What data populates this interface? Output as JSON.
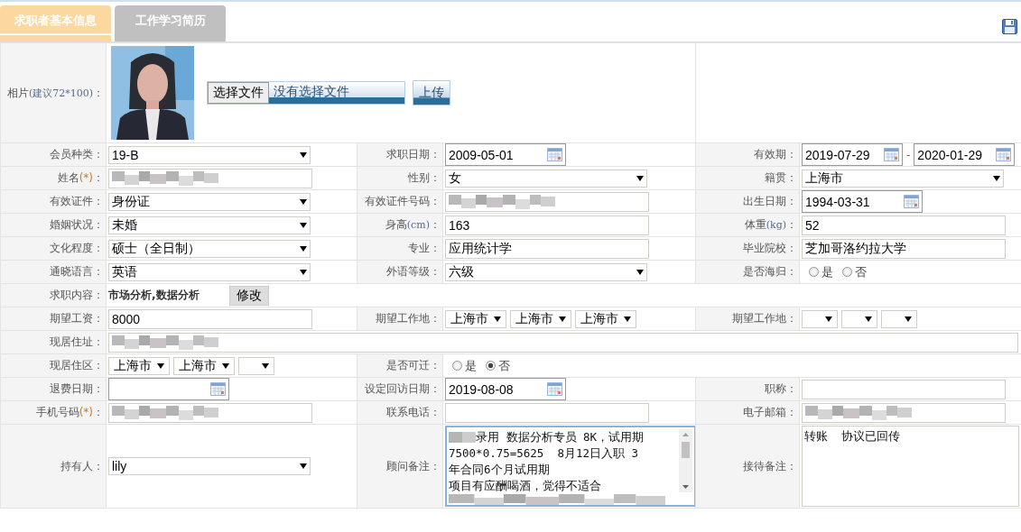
{
  "tabs": [
    {
      "label": "求职者基本信息",
      "selected": true
    },
    {
      "label": "工作学习简历",
      "selected": false
    }
  ],
  "rows": [
    {
      "label": [
        {
          "text": "相片"
        },
        {
          "text": "(建议72*100)",
          "kind": "hint"
        },
        {
          "text": "："
        }
      ],
      "upload": {
        "choose_button": "选择文件",
        "file_status": "没有选择文件",
        "upload_button": "上传"
      }
    },
    {
      "kind": "fields",
      "cells": [
        {
          "label": [
            {
              "text": "会员种类："
            }
          ],
          "field": {
            "kind": "select",
            "value": "19-B"
          }
        },
        {
          "label": [
            {
              "text": "求职日期："
            }
          ],
          "field": {
            "kind": "date",
            "value": "2009-05-01"
          }
        },
        {
          "label": [
            {
              "text": "有效期："
            }
          ],
          "field": {
            "kind": "daterange",
            "from": "2019-07-29",
            "separator": "-",
            "to": "2020-01-29"
          }
        }
      ]
    },
    {
      "kind": "fields",
      "cells": [
        {
          "label": [
            {
              "text": "姓名"
            },
            {
              "text": "(*)",
              "kind": "required"
            },
            {
              "text": "："
            }
          ],
          "field": {
            "kind": "text",
            "redacted": true
          }
        },
        {
          "label": [
            {
              "text": "性别："
            }
          ],
          "field": {
            "kind": "select",
            "value": "女"
          }
        },
        {
          "label": [
            {
              "text": "籍贯："
            }
          ],
          "field": {
            "kind": "select",
            "value": "上海市"
          }
        }
      ]
    },
    {
      "kind": "fields",
      "cells": [
        {
          "label": [
            {
              "text": "有效证件："
            }
          ],
          "field": {
            "kind": "select",
            "value": "身份证"
          }
        },
        {
          "label": [
            {
              "text": "有效证件号码："
            }
          ],
          "field": {
            "kind": "text",
            "redacted": true
          }
        },
        {
          "label": [
            {
              "text": "出生日期："
            }
          ],
          "field": {
            "kind": "date",
            "value": "1994-03-31"
          }
        }
      ]
    },
    {
      "kind": "fields",
      "cells": [
        {
          "label": [
            {
              "text": "婚姻状况："
            }
          ],
          "field": {
            "kind": "select",
            "value": "未婚"
          }
        },
        {
          "label": [
            {
              "text": "身高"
            },
            {
              "text": "(cm)",
              "kind": "hint"
            },
            {
              "text": "："
            }
          ],
          "field": {
            "kind": "text",
            "value": "163"
          }
        },
        {
          "label": [
            {
              "text": "体重"
            },
            {
              "text": "(kg)",
              "kind": "hint"
            },
            {
              "text": "："
            }
          ],
          "field": {
            "kind": "text",
            "value": "52"
          }
        }
      ]
    },
    {
      "kind": "fields",
      "cells": [
        {
          "label": [
            {
              "text": "文化程度："
            }
          ],
          "field": {
            "kind": "select",
            "value": "硕士（全日制）"
          }
        },
        {
          "label": [
            {
              "text": "专业："
            }
          ],
          "field": {
            "kind": "text",
            "value": "应用统计学"
          }
        },
        {
          "label": [
            {
              "text": "毕业院校："
            }
          ],
          "field": {
            "kind": "text",
            "value": "芝加哥洛约拉大学"
          }
        }
      ]
    },
    {
      "kind": "fields",
      "cells": [
        {
          "label": [
            {
              "text": "通晓语言："
            }
          ],
          "field": {
            "kind": "select",
            "value": "英语"
          }
        },
        {
          "label": [
            {
              "text": "外语等级："
            }
          ],
          "field": {
            "kind": "select",
            "value": "六级"
          }
        },
        {
          "label": [
            {
              "text": "是否海归："
            }
          ],
          "field": {
            "kind": "radio",
            "options": [
              {
                "label": "是",
                "selected": false
              },
              {
                "label": "否",
                "selected": false
              }
            ]
          }
        }
      ]
    },
    {
      "kind": "fields",
      "cells": [
        {
          "label": [
            {
              "text": "求职内容："
            }
          ],
          "field": {
            "kind": "tags",
            "text": "市场分析,数据分析",
            "button": "修改"
          }
        }
      ]
    },
    {
      "kind": "fields",
      "cells": [
        {
          "label": [
            {
              "text": "期望工资："
            }
          ],
          "field": {
            "kind": "text",
            "value": "8000"
          }
        },
        {
          "label": [
            {
              "text": "期望工作地："
            }
          ],
          "field": {
            "kind": "selects",
            "items": [
              {
                "value": "上海市"
              },
              {
                "value": "上海市"
              },
              {
                "value": "上海市"
              }
            ]
          }
        },
        {
          "label": [
            {
              "text": "期望工作地："
            }
          ],
          "field": {
            "kind": "selects",
            "items": [
              {
                "kind": "blank"
              },
              {
                "kind": "blank"
              },
              {
                "kind": "blank"
              }
            ]
          }
        }
      ]
    },
    {
      "kind": "fields",
      "cells": [
        {
          "label": [
            {
              "text": "现居住址："
            }
          ],
          "field": {
            "kind": "text",
            "redacted": true
          }
        }
      ]
    },
    {
      "kind": "fields",
      "cells": [
        {
          "label": [
            {
              "text": "现居住区："
            }
          ],
          "field": {
            "kind": "selects",
            "items": [
              {
                "value": "上海市"
              },
              {
                "value": "上海市"
              },
              {
                "kind": "blank"
              }
            ]
          }
        },
        {
          "label": [
            {
              "text": "是否可迁："
            }
          ],
          "field": {
            "kind": "radio",
            "options": [
              {
                "label": "是",
                "selected": false
              },
              {
                "label": "否",
                "selected": true
              }
            ]
          }
        }
      ]
    },
    {
      "kind": "fields",
      "cells": [
        {
          "label": [
            {
              "text": "退费日期："
            }
          ],
          "field": {
            "kind": "date"
          }
        },
        {
          "label": [
            {
              "text": "设定回访日期："
            }
          ],
          "field": {
            "kind": "date",
            "value": "2019-08-08"
          }
        },
        {
          "label": [
            {
              "text": "职称："
            }
          ],
          "field": {
            "kind": "text"
          }
        }
      ]
    },
    {
      "kind": "fields",
      "cells": [
        {
          "label": [
            {
              "text": "手机号码"
            },
            {
              "text": "(*)",
              "kind": "required"
            },
            {
              "text": "："
            }
          ],
          "field": {
            "kind": "text",
            "redacted": true
          }
        },
        {
          "label": [
            {
              "text": "联系电话："
            }
          ],
          "field": {
            "kind": "text"
          }
        },
        {
          "label": [
            {
              "text": "电子邮箱："
            }
          ],
          "field": {
            "kind": "text",
            "redacted": true
          }
        }
      ]
    },
    {
      "kind": "fields",
      "cells": [
        {
          "label": [
            {
              "text": "持有人："
            }
          ],
          "field": {
            "kind": "select",
            "value": "lily"
          }
        },
        {
          "label": [
            {
              "text": "顾问备注："
            }
          ],
          "field": {
            "kind": "textarea",
            "focused": true,
            "lines": [
              {
                "kind": "text",
                "redacted_prefix": true,
                "text": "录用 数据分析专员 8K，试用期"
              },
              {
                "kind": "text",
                "text": "7500*0.75=5625  8月12日入职 3"
              },
              {
                "kind": "text",
                "text": "年合同6个月试用期"
              },
              {
                "kind": "text",
                "text": "项目有应酬喝酒，觉得不适合"
              },
              {
                "kind": "redacted"
              }
            ]
          }
        },
        {
          "label": [
            {
              "text": "接待备注："
            }
          ],
          "field": {
            "kind": "textarea",
            "focused": false,
            "lines": [
              {
                "kind": "text",
                "text": "转账  协议已回传"
              }
            ]
          }
        }
      ]
    }
  ]
}
